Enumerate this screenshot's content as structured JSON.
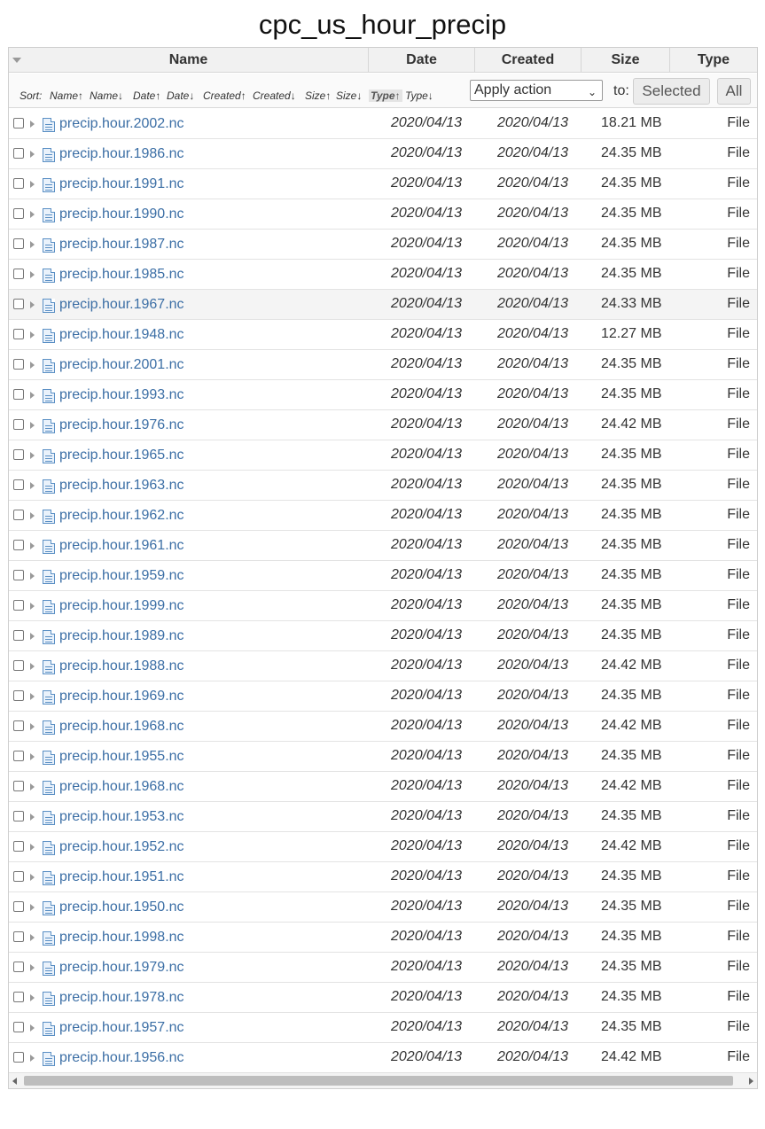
{
  "page": {
    "title": "cpc_us_hour_precip"
  },
  "columns": {
    "name": "Name",
    "date": "Date",
    "created": "Created",
    "size": "Size",
    "type": "Type"
  },
  "toolbar": {
    "sort_label": "Sort:",
    "sort_options": [
      "Name↑",
      "Name↓",
      "Date↑",
      "Date↓",
      "Created↑",
      "Created↓",
      "Size↑",
      "Size↓",
      "Type↑",
      "Type↓"
    ],
    "active_sort": "Type↑",
    "action_select_value": "Apply action",
    "to_label": "to:",
    "selected_button": "Selected",
    "all_button": "All"
  },
  "files": [
    {
      "name": "precip.hour.2002.nc",
      "date": "2020/04/13",
      "created": "2020/04/13",
      "size": "18.21 MB",
      "type": "File"
    },
    {
      "name": "precip.hour.1986.nc",
      "date": "2020/04/13",
      "created": "2020/04/13",
      "size": "24.35 MB",
      "type": "File"
    },
    {
      "name": "precip.hour.1991.nc",
      "date": "2020/04/13",
      "created": "2020/04/13",
      "size": "24.35 MB",
      "type": "File"
    },
    {
      "name": "precip.hour.1990.nc",
      "date": "2020/04/13",
      "created": "2020/04/13",
      "size": "24.35 MB",
      "type": "File"
    },
    {
      "name": "precip.hour.1987.nc",
      "date": "2020/04/13",
      "created": "2020/04/13",
      "size": "24.35 MB",
      "type": "File"
    },
    {
      "name": "precip.hour.1985.nc",
      "date": "2020/04/13",
      "created": "2020/04/13",
      "size": "24.35 MB",
      "type": "File"
    },
    {
      "name": "precip.hour.1967.nc",
      "date": "2020/04/13",
      "created": "2020/04/13",
      "size": "24.33 MB",
      "type": "File"
    },
    {
      "name": "precip.hour.1948.nc",
      "date": "2020/04/13",
      "created": "2020/04/13",
      "size": "12.27 MB",
      "type": "File"
    },
    {
      "name": "precip.hour.2001.nc",
      "date": "2020/04/13",
      "created": "2020/04/13",
      "size": "24.35 MB",
      "type": "File"
    },
    {
      "name": "precip.hour.1993.nc",
      "date": "2020/04/13",
      "created": "2020/04/13",
      "size": "24.35 MB",
      "type": "File"
    },
    {
      "name": "precip.hour.1976.nc",
      "date": "2020/04/13",
      "created": "2020/04/13",
      "size": "24.42 MB",
      "type": "File"
    },
    {
      "name": "precip.hour.1965.nc",
      "date": "2020/04/13",
      "created": "2020/04/13",
      "size": "24.35 MB",
      "type": "File"
    },
    {
      "name": "precip.hour.1963.nc",
      "date": "2020/04/13",
      "created": "2020/04/13",
      "size": "24.35 MB",
      "type": "File"
    },
    {
      "name": "precip.hour.1962.nc",
      "date": "2020/04/13",
      "created": "2020/04/13",
      "size": "24.35 MB",
      "type": "File"
    },
    {
      "name": "precip.hour.1961.nc",
      "date": "2020/04/13",
      "created": "2020/04/13",
      "size": "24.35 MB",
      "type": "File"
    },
    {
      "name": "precip.hour.1959.nc",
      "date": "2020/04/13",
      "created": "2020/04/13",
      "size": "24.35 MB",
      "type": "File"
    },
    {
      "name": "precip.hour.1999.nc",
      "date": "2020/04/13",
      "created": "2020/04/13",
      "size": "24.35 MB",
      "type": "File"
    },
    {
      "name": "precip.hour.1989.nc",
      "date": "2020/04/13",
      "created": "2020/04/13",
      "size": "24.35 MB",
      "type": "File"
    },
    {
      "name": "precip.hour.1988.nc",
      "date": "2020/04/13",
      "created": "2020/04/13",
      "size": "24.42 MB",
      "type": "File"
    },
    {
      "name": "precip.hour.1969.nc",
      "date": "2020/04/13",
      "created": "2020/04/13",
      "size": "24.35 MB",
      "type": "File"
    },
    {
      "name": "precip.hour.1968.nc",
      "date": "2020/04/13",
      "created": "2020/04/13",
      "size": "24.42 MB",
      "type": "File"
    },
    {
      "name": "precip.hour.1955.nc",
      "date": "2020/04/13",
      "created": "2020/04/13",
      "size": "24.35 MB",
      "type": "File"
    },
    {
      "name": "precip.hour.1968.nc",
      "date": "2020/04/13",
      "created": "2020/04/13",
      "size": "24.42 MB",
      "type": "File"
    },
    {
      "name": "precip.hour.1953.nc",
      "date": "2020/04/13",
      "created": "2020/04/13",
      "size": "24.35 MB",
      "type": "File"
    },
    {
      "name": "precip.hour.1952.nc",
      "date": "2020/04/13",
      "created": "2020/04/13",
      "size": "24.42 MB",
      "type": "File"
    },
    {
      "name": "precip.hour.1951.nc",
      "date": "2020/04/13",
      "created": "2020/04/13",
      "size": "24.35 MB",
      "type": "File"
    },
    {
      "name": "precip.hour.1950.nc",
      "date": "2020/04/13",
      "created": "2020/04/13",
      "size": "24.35 MB",
      "type": "File"
    },
    {
      "name": "precip.hour.1998.nc",
      "date": "2020/04/13",
      "created": "2020/04/13",
      "size": "24.35 MB",
      "type": "File"
    },
    {
      "name": "precip.hour.1979.nc",
      "date": "2020/04/13",
      "created": "2020/04/13",
      "size": "24.35 MB",
      "type": "File"
    },
    {
      "name": "precip.hour.1978.nc",
      "date": "2020/04/13",
      "created": "2020/04/13",
      "size": "24.35 MB",
      "type": "File"
    },
    {
      "name": "precip.hour.1957.nc",
      "date": "2020/04/13",
      "created": "2020/04/13",
      "size": "24.35 MB",
      "type": "File"
    },
    {
      "name": "precip.hour.1956.nc",
      "date": "2020/04/13",
      "created": "2020/04/13",
      "size": "24.42 MB",
      "type": "File"
    }
  ]
}
